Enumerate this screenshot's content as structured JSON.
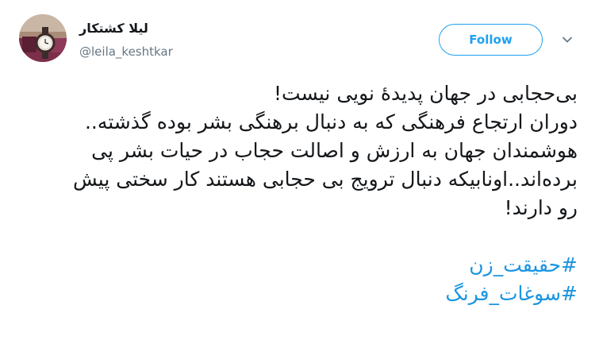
{
  "author": {
    "display_name": "لیلا کشتکار",
    "handle": "@leila_keshtkar"
  },
  "actions": {
    "follow_label": "Follow"
  },
  "tweet": {
    "lines": [
      "بی‌حجابی در جهان پدیدهٔ نویی نیست!",
      "دوران ارتجاع فرهنگی که به دنبال برهنگی بشر بوده گذشته..",
      "هوشمندان جهان به ارزش و اصالت حجاب در حیات بشر پی",
      "برده‌اند..اونابیکه دنبال ترویج بی حجابی هستند کار سختی پیش",
      "رو دارند!"
    ],
    "hashtags": [
      "#حقیقت_زن",
      "#سوغات_فرنگ"
    ]
  },
  "colors": {
    "accent": "#1da1f2",
    "hashtag": "#1b95e0",
    "text": "#14171a",
    "muted": "#657786"
  },
  "icons": {
    "avatar": "avatar-photo",
    "caret": "chevron-down-icon"
  }
}
